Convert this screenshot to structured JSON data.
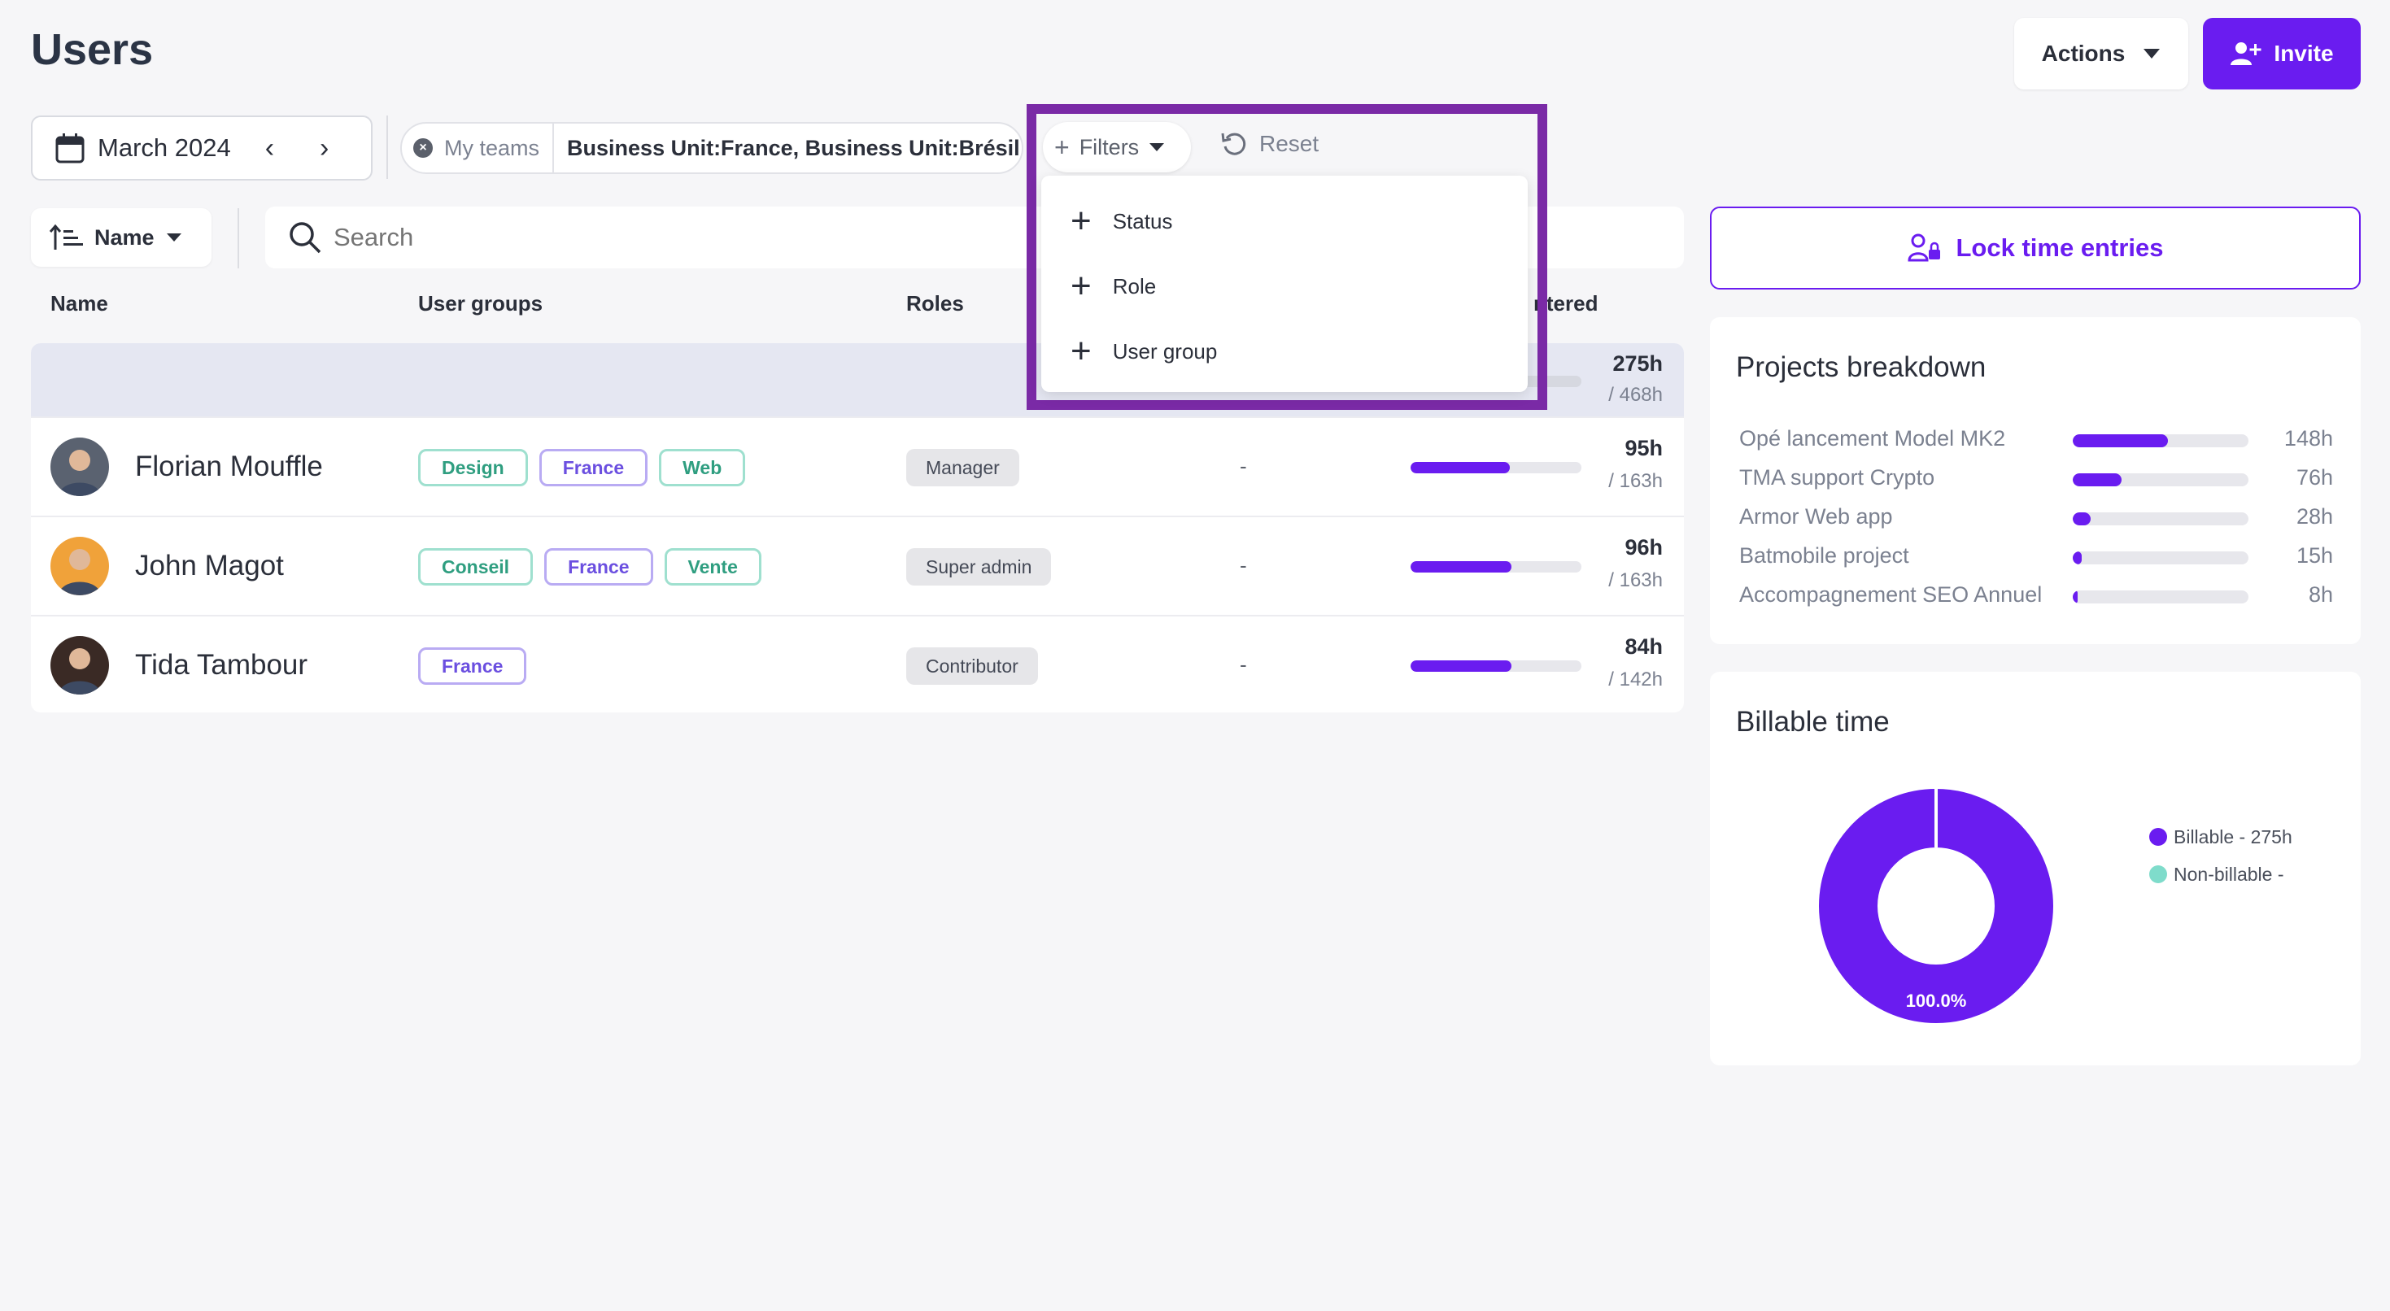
{
  "page_title": "Users",
  "header": {
    "actions_label": "Actions",
    "invite_label": "Invite"
  },
  "date_picker": {
    "label": "March 2024"
  },
  "team_chip": {
    "label": "My teams",
    "value": "Business Unit:France, Business Unit:Brésil"
  },
  "filters": {
    "button_label": "Filters",
    "reset_label": "Reset",
    "menu": [
      {
        "label": "Status"
      },
      {
        "label": "Role"
      },
      {
        "label": "User group"
      }
    ]
  },
  "sort": {
    "label": "Name"
  },
  "search": {
    "placeholder": "Search"
  },
  "table": {
    "headers": {
      "name": "Name",
      "groups": "User groups",
      "roles": "Roles",
      "entered": "ntered"
    },
    "total": {
      "hours": "275h",
      "capacity": "/ 468h",
      "fill": 0.59
    },
    "rows": [
      {
        "name": "Florian Mouffle",
        "groups": [
          {
            "label": "Design",
            "color": "green"
          },
          {
            "label": "France",
            "color": "purple"
          },
          {
            "label": "Web",
            "color": "green"
          }
        ],
        "role": "Manager",
        "dash": "-",
        "hours": "95h",
        "capacity": "/ 163h",
        "fill": 0.58,
        "avatar_color": "#5a6270"
      },
      {
        "name": "John Magot",
        "groups": [
          {
            "label": "Conseil",
            "color": "green"
          },
          {
            "label": "France",
            "color": "purple"
          },
          {
            "label": "Vente",
            "color": "green"
          }
        ],
        "role": "Super admin",
        "dash": "-",
        "hours": "96h",
        "capacity": "/ 163h",
        "fill": 0.59,
        "avatar_color": "#f0a23a"
      },
      {
        "name": "Tida Tambour",
        "groups": [
          {
            "label": "France",
            "color": "purple"
          }
        ],
        "role": "Contributor",
        "dash": "-",
        "hours": "84h",
        "capacity": "/ 142h",
        "fill": 0.59,
        "avatar_color": "#3a2a25"
      }
    ]
  },
  "lock": {
    "label": "Lock time entries"
  },
  "projects": {
    "title": "Projects breakdown",
    "items": [
      {
        "name": "Opé lancement Model MK2",
        "hours": "148h",
        "fill": 0.54
      },
      {
        "name": "TMA support Crypto",
        "hours": "76h",
        "fill": 0.28
      },
      {
        "name": "Armor Web app",
        "hours": "28h",
        "fill": 0.1
      },
      {
        "name": "Batmobile project",
        "hours": "15h",
        "fill": 0.05
      },
      {
        "name": "Accompagnement SEO Annuel",
        "hours": "8h",
        "fill": 0.03
      }
    ]
  },
  "billable": {
    "title": "Billable time",
    "percent_label": "100.0%",
    "legend": [
      {
        "label": "Billable - 275h",
        "color": "#6a1cf0"
      },
      {
        "label": "Non-billable -",
        "color": "#7fdccb"
      }
    ]
  },
  "colors": {
    "accent": "#6a1cf0",
    "highlight_border": "#7a2aa6"
  }
}
